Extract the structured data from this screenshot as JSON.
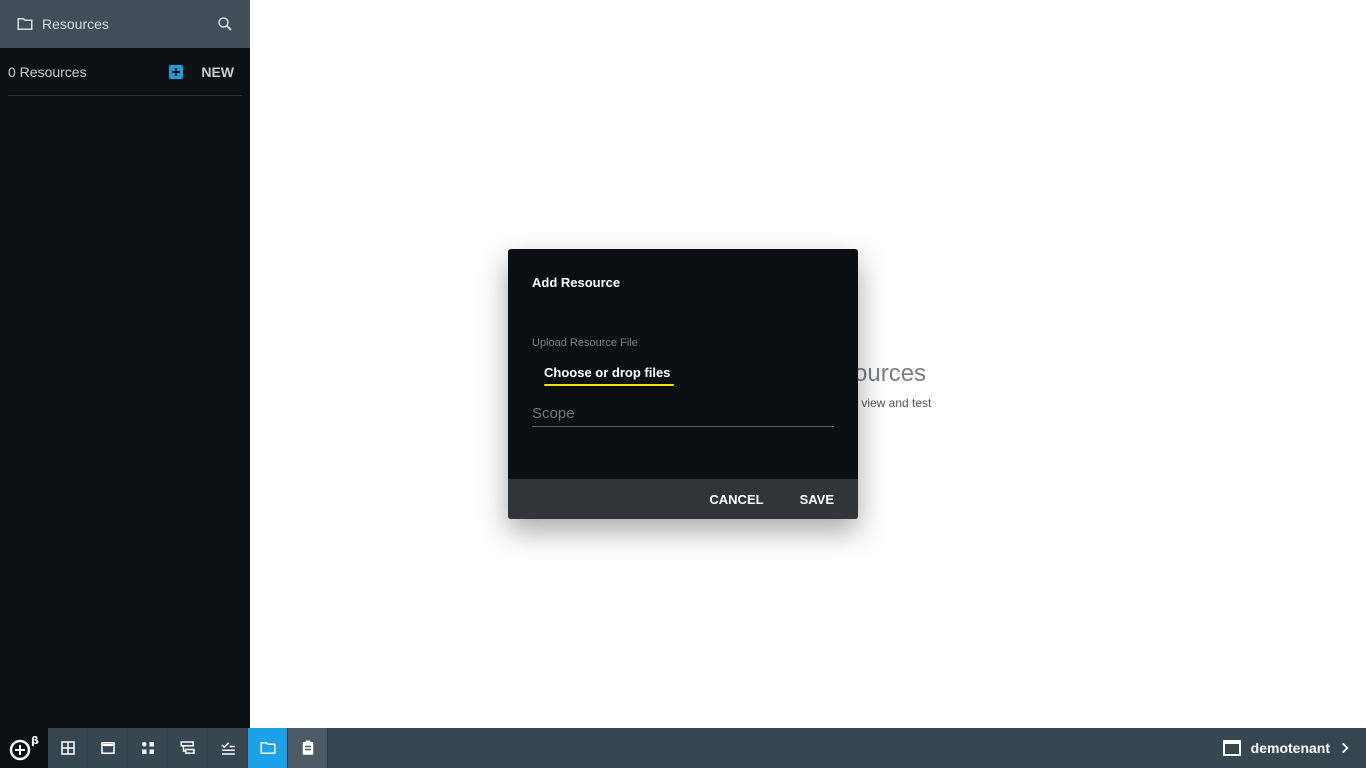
{
  "sidebar": {
    "title": "Resources",
    "count_text": "0 Resources",
    "new_label": "NEW"
  },
  "background": {
    "empty_title_partial": "sources",
    "empty_sub_partial": "l to view and test"
  },
  "dialog": {
    "title": "Add Resource",
    "upload_label": "Upload Resource File",
    "choose_label": "Choose or drop files",
    "scope_placeholder": "Scope",
    "cancel_label": "CANCEL",
    "save_label": "SAVE"
  },
  "taskbar": {
    "logo_text": "éᵝ",
    "tenant_label": "demotenant",
    "icons": [
      "dashboard-grid-icon",
      "window-icon",
      "widgets-icon",
      "routes-icon",
      "checklist-icon",
      "folder-icon",
      "clipboard-icon"
    ]
  },
  "colors": {
    "accent": "#1aa1e6",
    "highlight": "#f2e40a",
    "sidebar_bg": "#0c1013",
    "taskbar_bg": "#374752"
  }
}
